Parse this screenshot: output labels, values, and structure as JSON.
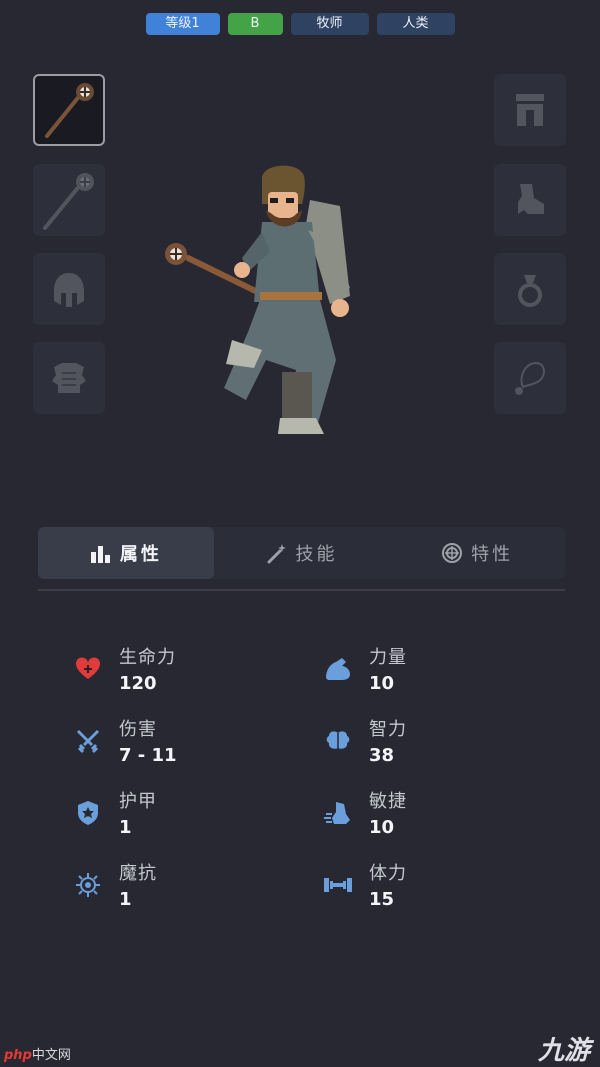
{
  "header": {
    "level": "等级1",
    "grade": "B",
    "class_name": "牧师",
    "race": "人类"
  },
  "equipment": {
    "left_slots": [
      "staff-icon",
      "staff-icon",
      "helmet-icon",
      "chest-armor-icon"
    ],
    "right_slots": [
      "pants-icon",
      "boot-icon",
      "ring-icon",
      "amulet-icon"
    ]
  },
  "tabs": [
    {
      "label": "属性",
      "icon": "bar-chart-icon",
      "active": true
    },
    {
      "label": "技能",
      "icon": "magic-wand-icon",
      "active": false
    },
    {
      "label": "特性",
      "icon": "trait-icon",
      "active": false
    }
  ],
  "stats": [
    {
      "label": "生命力",
      "value": "120",
      "icon": "heart-icon"
    },
    {
      "label": "力量",
      "value": "10",
      "icon": "strength-arm-icon"
    },
    {
      "label": "伤害",
      "value": "7 - 11",
      "icon": "crossed-swords-icon"
    },
    {
      "label": "智力",
      "value": "38",
      "icon": "brain-icon"
    },
    {
      "label": "护甲",
      "value": "1",
      "icon": "shield-icon"
    },
    {
      "label": "敏捷",
      "value": "10",
      "icon": "agility-boot-icon"
    },
    {
      "label": "魔抗",
      "value": "1",
      "icon": "magic-resist-icon"
    },
    {
      "label": "体力",
      "value": "15",
      "icon": "dumbbell-icon"
    }
  ],
  "watermarks": {
    "left_brand": "php",
    "left_text": "中文网",
    "right_text": "九游"
  },
  "colors": {
    "background": "#272832",
    "level_badge": "#3f82d8",
    "grade_badge": "#45a347",
    "info_badge": "#2f4262",
    "stat_icon": "#6a9fdc",
    "heart": "#e03c3c"
  }
}
